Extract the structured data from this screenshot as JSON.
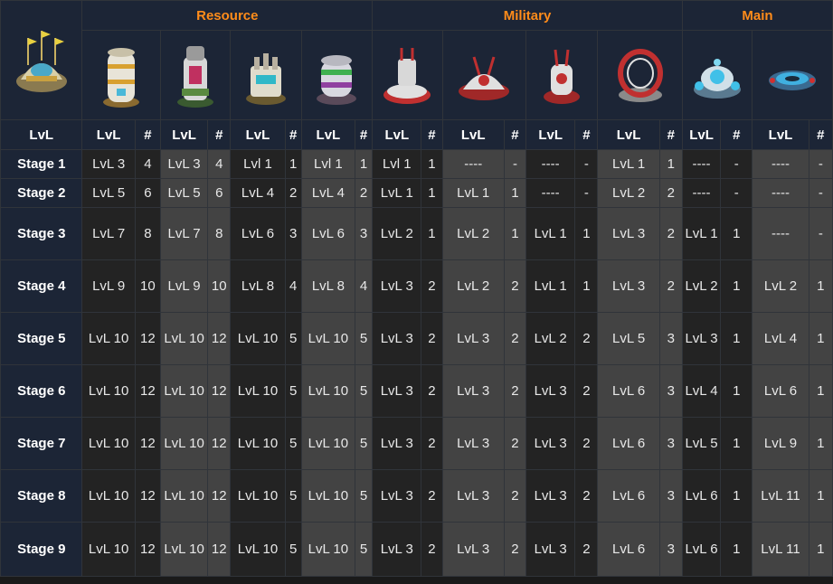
{
  "groups": {
    "resource": "Resource",
    "military": "Military",
    "main": "Main"
  },
  "subheaders": {
    "lvl": "LvL",
    "count": "#"
  },
  "buildings": [
    {
      "icon": "command-center-icon",
      "group": "corner"
    },
    {
      "icon": "storage-silo-icon",
      "group": "resource"
    },
    {
      "icon": "refinery-icon",
      "group": "resource"
    },
    {
      "icon": "factory-icon",
      "group": "resource"
    },
    {
      "icon": "reactor-icon",
      "group": "resource"
    },
    {
      "icon": "missile-turret-icon",
      "group": "military"
    },
    {
      "icon": "artillery-icon",
      "group": "military"
    },
    {
      "icon": "rocket-launcher-icon",
      "group": "military"
    },
    {
      "icon": "ring-cannon-icon",
      "group": "military"
    },
    {
      "icon": "shield-generator-icon",
      "group": "main"
    },
    {
      "icon": "landing-pad-icon",
      "group": "main"
    }
  ],
  "rows": [
    {
      "stage": "Stage 1",
      "cells": [
        "LvL 3",
        "4",
        "LvL 3",
        "4",
        "Lvl 1",
        "1",
        "Lvl 1",
        "1",
        "Lvl 1",
        "1",
        "----",
        "-",
        "----",
        "-",
        "LvL 1",
        "1",
        "----",
        "-",
        "----",
        "-"
      ]
    },
    {
      "stage": "Stage 2",
      "cells": [
        "LvL 5",
        "6",
        "LvL 5",
        "6",
        "LvL 4",
        "2",
        "LvL 4",
        "2",
        "LvL 1",
        "1",
        "LvL 1",
        "1",
        "----",
        "-",
        "LvL 2",
        "2",
        "----",
        "-",
        "----",
        "-"
      ]
    },
    {
      "stage": "Stage 3",
      "cells": [
        "LvL 7",
        "8",
        "LvL 7",
        "8",
        "LvL 6",
        "3",
        "LvL 6",
        "3",
        "LvL 2",
        "1",
        "LvL 2",
        "1",
        "LvL 1",
        "1",
        "LvL 3",
        "2",
        "LvL 1",
        "1",
        "----",
        "-"
      ]
    },
    {
      "stage": "Stage 4",
      "cells": [
        "LvL 9",
        "10",
        "LvL 9",
        "10",
        "LvL 8",
        "4",
        "LvL 8",
        "4",
        "LvL 3",
        "2",
        "LvL 2",
        "2",
        "LvL 1",
        "1",
        "LvL 3",
        "2",
        "LvL 2",
        "1",
        "LvL 2",
        "1"
      ]
    },
    {
      "stage": "Stage 5",
      "cells": [
        "LvL 10",
        "12",
        "LvL 10",
        "12",
        "LvL 10",
        "5",
        "LvL 10",
        "5",
        "LvL 3",
        "2",
        "LvL 3",
        "2",
        "LvL 2",
        "2",
        "LvL 5",
        "3",
        "LvL 3",
        "1",
        "LvL 4",
        "1"
      ]
    },
    {
      "stage": "Stage 6",
      "cells": [
        "LvL 10",
        "12",
        "LvL 10",
        "12",
        "LvL 10",
        "5",
        "LvL 10",
        "5",
        "LvL 3",
        "2",
        "LvL 3",
        "2",
        "LvL 3",
        "2",
        "LvL 6",
        "3",
        "LvL 4",
        "1",
        "LvL 6",
        "1"
      ]
    },
    {
      "stage": "Stage 7",
      "cells": [
        "LvL 10",
        "12",
        "LvL 10",
        "12",
        "LvL 10",
        "5",
        "LvL 10",
        "5",
        "LvL 3",
        "2",
        "LvL 3",
        "2",
        "LvL 3",
        "2",
        "LvL 6",
        "3",
        "LvL 5",
        "1",
        "LvL 9",
        "1"
      ]
    },
    {
      "stage": "Stage 8",
      "cells": [
        "LvL 10",
        "12",
        "LvL 10",
        "12",
        "LvL 10",
        "5",
        "LvL 10",
        "5",
        "LvL 3",
        "2",
        "LvL 3",
        "2",
        "LvL 3",
        "2",
        "LvL 6",
        "3",
        "LvL 6",
        "1",
        "LvL 11",
        "1"
      ]
    },
    {
      "stage": "Stage 9",
      "cells": [
        "LvL 10",
        "12",
        "LvL 10",
        "12",
        "LvL 10",
        "5",
        "LvL 10",
        "5",
        "LvL 3",
        "2",
        "LvL 3",
        "2",
        "LvL 3",
        "2",
        "LvL 6",
        "3",
        "LvL 6",
        "1",
        "LvL 11",
        "1"
      ]
    }
  ]
}
